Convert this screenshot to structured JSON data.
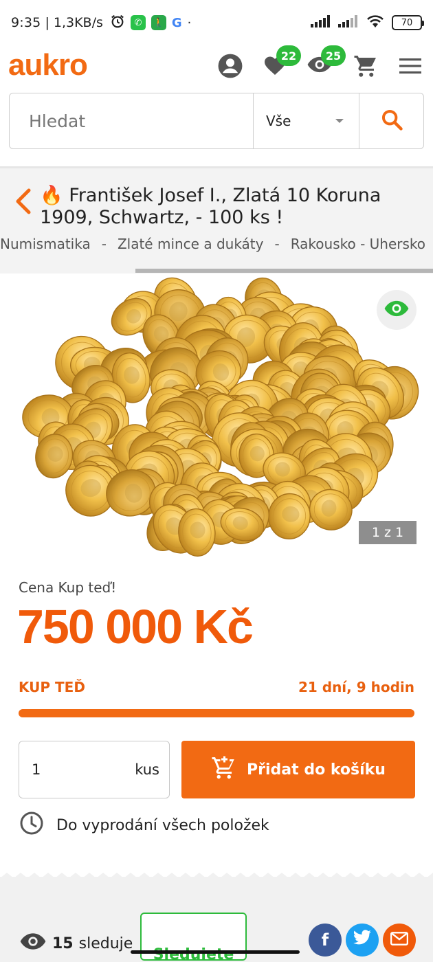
{
  "status": {
    "time": "9:35",
    "speed": "1,3KB/s",
    "battery": "70"
  },
  "header": {
    "logo": "aukro",
    "favorites_count": "22",
    "watched_count": "25"
  },
  "search": {
    "placeholder": "Hledat",
    "category": "Vše"
  },
  "item": {
    "title_emoji": "🔥",
    "title": "František Josef I., Zlatá 10 Koruna 1909, Schwartz, - 100 ks !",
    "breadcrumbs": [
      "Numismatika",
      "Zlaté mince a dukáty",
      "Rakousko - Uhersko"
    ],
    "image_counter": "1 z 1"
  },
  "price": {
    "label": "Cena Kup teď!",
    "value": "750 000 Kč",
    "buy_label": "KUP TEĎ",
    "time_left": "21 dní, 9 hodin"
  },
  "cart": {
    "quantity": "1",
    "unit": "kus",
    "add_label": "Přidat do košíku"
  },
  "stock_text": "Do vyprodání všech položek",
  "bottom": {
    "watchers_count": "15",
    "watchers_label": "sleduje",
    "follow_label": "Sledujete"
  },
  "colors": {
    "brand": "#f26a13",
    "green": "#2dba3b"
  }
}
